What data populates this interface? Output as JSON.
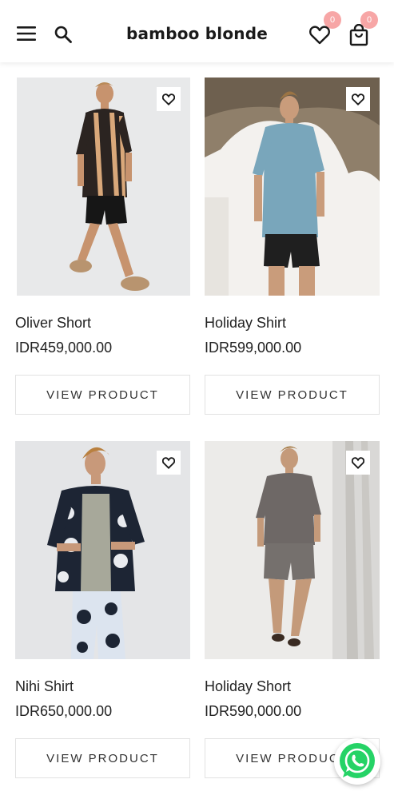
{
  "header": {
    "brand": "bamboo blonde",
    "wishlist_count": "0",
    "cart_count": "0"
  },
  "products": [
    {
      "name": "Oliver Short",
      "price": "IDR459,000.00",
      "button": "VIEW PRODUCT"
    },
    {
      "name": "Holiday Shirt",
      "price": "IDR599,000.00",
      "button": "VIEW PRODUCT"
    },
    {
      "name": "Nihi Shirt",
      "price": "IDR650,000.00",
      "button": "VIEW PRODUCT"
    },
    {
      "name": "Holiday Short",
      "price": "IDR590,000.00",
      "button": "VIEW PRODUCT"
    }
  ],
  "icons": {
    "menu": "menu-icon",
    "search": "search-icon",
    "wishlist": "heart-icon",
    "cart": "shopping-bag-icon",
    "favorite": "heart-icon",
    "whatsapp": "whatsapp-icon"
  },
  "colors": {
    "badge": "#f7a6a6",
    "whatsapp": "#25d366"
  }
}
